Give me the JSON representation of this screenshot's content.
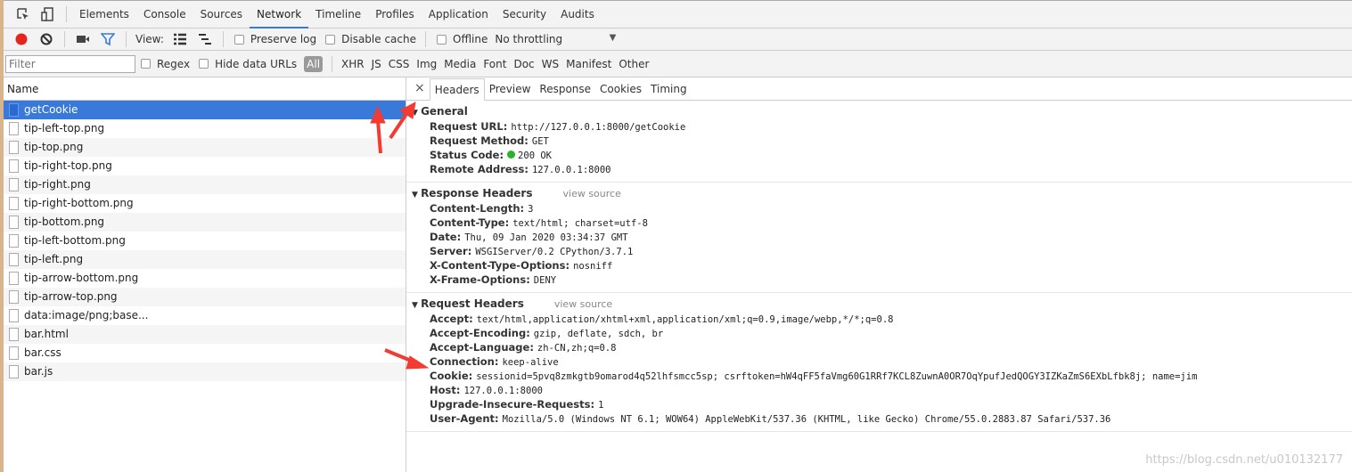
{
  "tabs": [
    "Elements",
    "Console",
    "Sources",
    "Network",
    "Timeline",
    "Profiles",
    "Application",
    "Security",
    "Audits"
  ],
  "active_tab": "Network",
  "toolbar": {
    "view_label": "View:",
    "preserve_log": "Preserve log",
    "disable_cache": "Disable cache",
    "offline": "Offline",
    "throttling": "No throttling"
  },
  "filterbar": {
    "placeholder": "Filter",
    "regex": "Regex",
    "hide_data_urls": "Hide data URLs",
    "types": [
      "All",
      "XHR",
      "JS",
      "CSS",
      "Img",
      "Media",
      "Font",
      "Doc",
      "WS",
      "Manifest",
      "Other"
    ]
  },
  "requests": {
    "header": "Name",
    "items": [
      "getCookie",
      "tip-left-top.png",
      "tip-top.png",
      "tip-right-top.png",
      "tip-right.png",
      "tip-right-bottom.png",
      "tip-bottom.png",
      "tip-left-bottom.png",
      "tip-left.png",
      "tip-arrow-bottom.png",
      "tip-arrow-top.png",
      "data:image/png;base...",
      "bar.html",
      "bar.css",
      "bar.js"
    ]
  },
  "detail": {
    "close": "×",
    "tabs": [
      "Headers",
      "Preview",
      "Response",
      "Cookies",
      "Timing"
    ],
    "general": {
      "title": "General",
      "rows": [
        [
          "Request URL:",
          "http://127.0.0.1:8000/getCookie"
        ],
        [
          "Request Method:",
          "GET"
        ],
        [
          "Status Code:",
          "200 OK"
        ],
        [
          "Remote Address:",
          "127.0.0.1:8000"
        ]
      ]
    },
    "response": {
      "title": "Response Headers",
      "view_source": "view source",
      "rows": [
        [
          "Content-Length:",
          "3"
        ],
        [
          "Content-Type:",
          "text/html; charset=utf-8"
        ],
        [
          "Date:",
          "Thu, 09 Jan 2020 03:34:37 GMT"
        ],
        [
          "Server:",
          "WSGIServer/0.2 CPython/3.7.1"
        ],
        [
          "X-Content-Type-Options:",
          "nosniff"
        ],
        [
          "X-Frame-Options:",
          "DENY"
        ]
      ]
    },
    "request": {
      "title": "Request Headers",
      "view_source": "view source",
      "rows": [
        [
          "Accept:",
          "text/html,application/xhtml+xml,application/xml;q=0.9,image/webp,*/*;q=0.8"
        ],
        [
          "Accept-Encoding:",
          "gzip, deflate, sdch, br"
        ],
        [
          "Accept-Language:",
          "zh-CN,zh;q=0.8"
        ],
        [
          "Connection:",
          "keep-alive"
        ],
        [
          "Cookie:",
          "sessionid=5pvq8zmkgtb9omarod4q52lhfsmcc5sp; csrftoken=hW4qFF5faVmg60G1RRf7KCL8ZuwnA0OR7OqYpufJedQOGY3IZKaZmS6EXbLfbk8j; name=jim"
        ],
        [
          "Host:",
          "127.0.0.1:8000"
        ],
        [
          "Upgrade-Insecure-Requests:",
          "1"
        ],
        [
          "User-Agent:",
          "Mozilla/5.0 (Windows NT 6.1; WOW64) AppleWebKit/537.36 (KHTML, like Gecko) Chrome/55.0.2883.87 Safari/537.36"
        ]
      ]
    }
  },
  "watermark": "https://blog.csdn.net/u010132177",
  "colors": {
    "accent": "#3879d9",
    "record": "#e0261e",
    "status_ok": "#2bb32b",
    "annotation_arrow": "#f23b32"
  }
}
